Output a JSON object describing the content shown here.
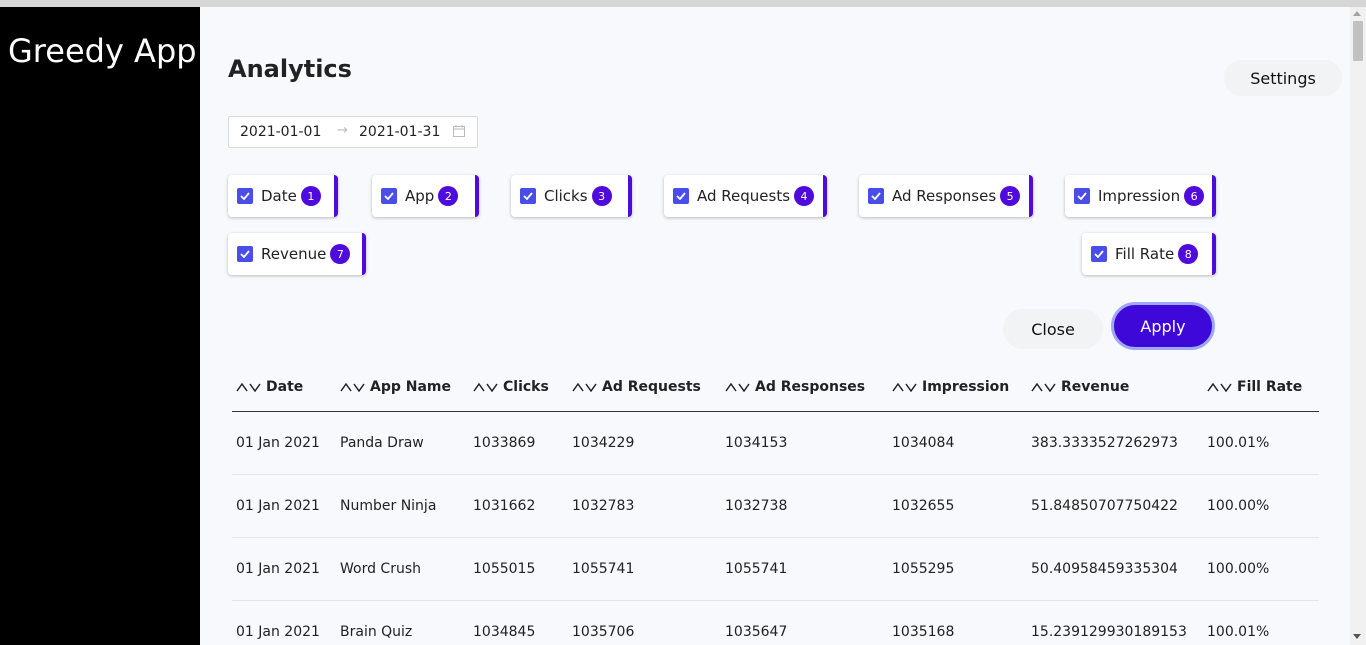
{
  "app": {
    "brand": "Greedy App"
  },
  "page": {
    "title": "Analytics",
    "settings_label": "Settings"
  },
  "date_range": {
    "start": "2021-01-01",
    "separator": "→",
    "end": "2021-01-31"
  },
  "column_chips": [
    {
      "label": "Date",
      "order": "1",
      "checked": true
    },
    {
      "label": "App",
      "order": "2",
      "checked": true
    },
    {
      "label": "Clicks",
      "order": "3",
      "checked": true
    },
    {
      "label": "Ad Requests",
      "order": "4",
      "checked": true
    },
    {
      "label": "Ad Responses",
      "order": "5",
      "checked": true
    },
    {
      "label": "Impression",
      "order": "6",
      "checked": true
    },
    {
      "label": "Revenue",
      "order": "7",
      "checked": true
    },
    {
      "label": "Fill Rate",
      "order": "8",
      "checked": true
    }
  ],
  "actions": {
    "close_label": "Close",
    "apply_label": "Apply"
  },
  "table": {
    "headers": [
      "Date",
      "App Name",
      "Clicks",
      "Ad Requests",
      "Ad Responses",
      "Impression",
      "Revenue",
      "Fill Rate"
    ],
    "rows": [
      [
        "01 Jan 2021",
        "Panda Draw",
        "1033869",
        "1034229",
        "1034153",
        "1034084",
        "383.3333527262973",
        "100.01%"
      ],
      [
        "01 Jan 2021",
        "Number Ninja",
        "1031662",
        "1032783",
        "1032738",
        "1032655",
        "51.84850707750422",
        "100.00%"
      ],
      [
        "01 Jan 2021",
        "Word Crush",
        "1055015",
        "1055741",
        "1055741",
        "1055295",
        "50.40958459335304",
        "100.00%"
      ],
      [
        "01 Jan 2021",
        "Brain Quiz",
        "1034845",
        "1035706",
        "1035647",
        "1035168",
        "15.239129930189153",
        "100.01%"
      ]
    ]
  },
  "colors": {
    "accent": "#4f0bdb",
    "apply": "#3e08d8",
    "checkbox": "#4a4ee8",
    "sidebar": "#000000"
  }
}
